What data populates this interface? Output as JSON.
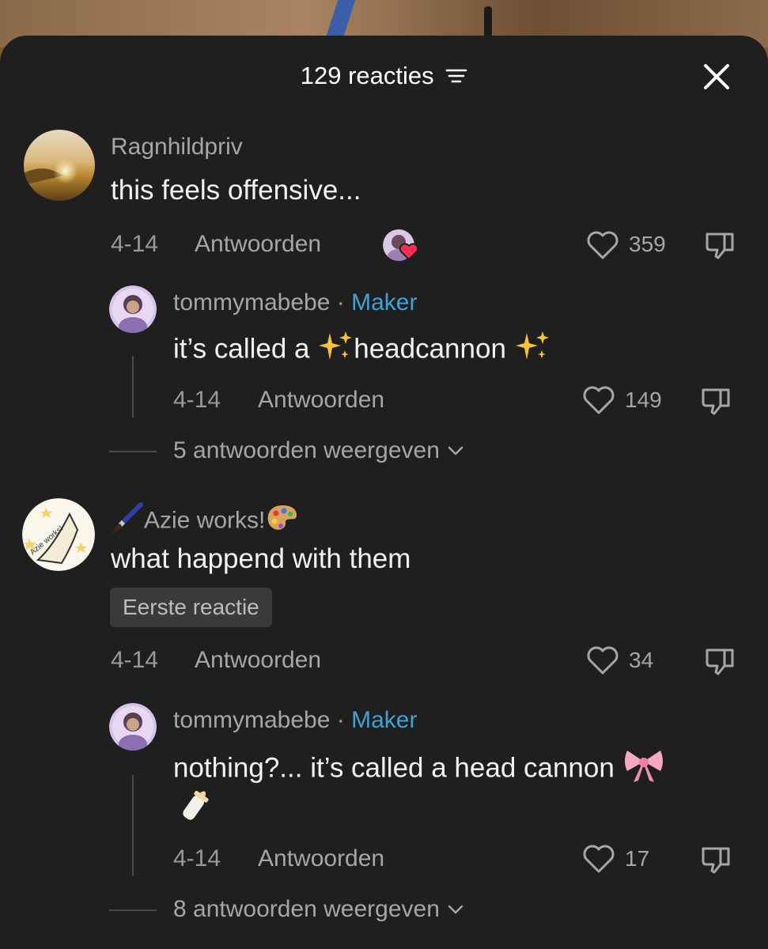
{
  "header": {
    "title": "129 reacties"
  },
  "comments": [
    {
      "username": "Ragnhildpriv",
      "text": "this feels offensive...",
      "date": "4-14",
      "reply_label": "Antwoorden",
      "likes": "359",
      "replies": [
        {
          "username": "tommymabebe",
          "separator": " · ",
          "role": "Maker",
          "text_part1": "it’s called a ",
          "text_part2": "headcannon",
          "date": "4-14",
          "reply_label": "Antwoorden",
          "likes": "149"
        }
      ],
      "view_replies": "5 antwoorden weergeven"
    },
    {
      "username": "Azie works!",
      "text": "what happend with them",
      "badge": "Eerste reactie",
      "date": "4-14",
      "reply_label": "Antwoorden",
      "likes": "34",
      "replies": [
        {
          "username": "tommymabebe",
          "separator": " · ",
          "role": "Maker",
          "text_line1": "nothing?... it’s called a head cannon",
          "date": "4-14",
          "reply_label": "Antwoorden",
          "likes": "17"
        }
      ],
      "view_replies": "8 antwoorden weergeven"
    }
  ],
  "avatar_lettering": "Azie works!",
  "icons": [
    "filter-icon",
    "close-icon",
    "heart-icon",
    "dislike-icon",
    "chevron-down-icon",
    "sparkles-icon",
    "bow-icon",
    "baby-bottle-icon",
    "paintbrush-icon",
    "palette-icon"
  ],
  "colors": {
    "sheet": "#1f1f1f",
    "maker": "#3ea2d6",
    "muted": "#a6a6a6",
    "text": "#f2f2f2"
  }
}
